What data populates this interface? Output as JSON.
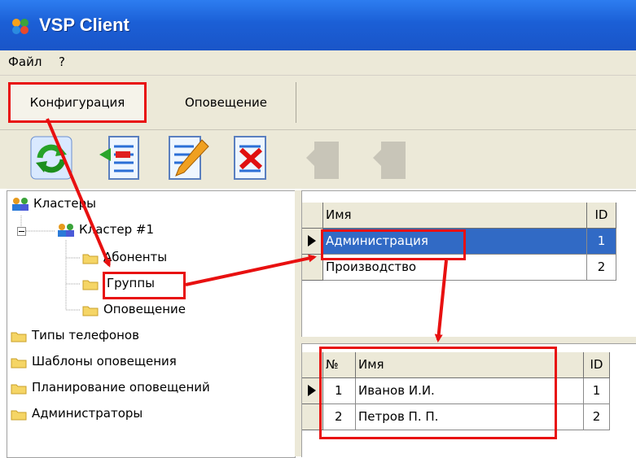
{
  "window": {
    "title": "VSP Client"
  },
  "menu": {
    "file": "Файл",
    "help": "?"
  },
  "tabs": [
    {
      "label": "Конфигурация"
    },
    {
      "label": "Оповещение"
    }
  ],
  "toolbar": {
    "icons": [
      "refresh-icon",
      "import-icon",
      "edit-icon",
      "delete-icon",
      "move-up-icon",
      "move-down-icon"
    ]
  },
  "tree": {
    "root": "Кластеры",
    "cluster": "Кластер #1",
    "children": [
      "Абоненты",
      "Группы",
      "Оповещение"
    ],
    "folders": [
      "Типы телефонов",
      "Шаблоны оповещения",
      "Планирование оповещений",
      "Администраторы"
    ]
  },
  "groups_table": {
    "headers": {
      "name": "Имя",
      "id": "ID"
    },
    "rows": [
      {
        "name": "Администрация",
        "id": "1"
      },
      {
        "name": "Производство",
        "id": "2"
      }
    ]
  },
  "members_table": {
    "headers": {
      "num": "№",
      "name": "Имя",
      "id": "ID"
    },
    "rows": [
      {
        "num": "1",
        "name": "Иванов И.И.",
        "id": "1"
      },
      {
        "num": "2",
        "name": "Петров П. П.",
        "id": "2"
      }
    ]
  },
  "colors": {
    "titlebar": "#1b5fd6",
    "selection": "#316ac5",
    "annotation": "#e81010"
  }
}
